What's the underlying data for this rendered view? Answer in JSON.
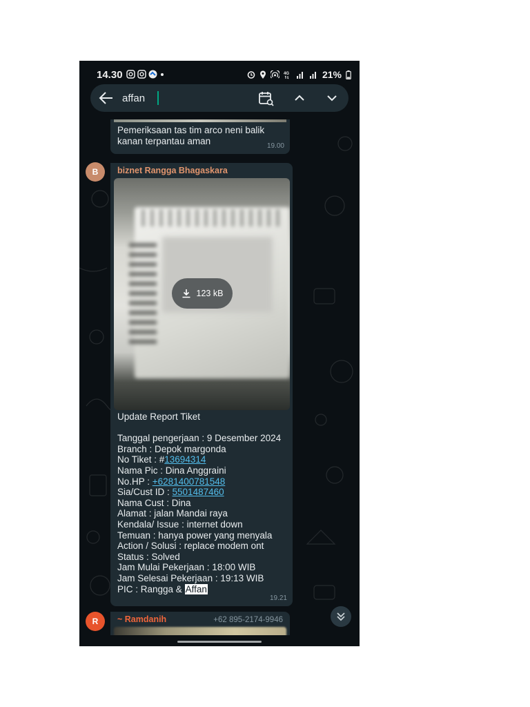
{
  "status_bar": {
    "time": "14.30",
    "battery": "21%"
  },
  "search": {
    "query": "affan"
  },
  "messages": [
    {
      "text_lines": [
        "Pemeriksaan tas tim arco neni balik",
        "kanan terpantau aman"
      ],
      "time": "19.00"
    },
    {
      "avatar_letter": "B",
      "avatar_color": "#c88b6b",
      "sender": "biznet Rangga Bhagaskara",
      "sender_color": "#e0946d",
      "attachment_size": "123 kB",
      "report": {
        "title": "Update Report Tiket",
        "tanggal": "Tanggal pengerjaan : 9 Desember 2024",
        "branch": "Branch : Depok margonda",
        "tiket_label": "No Tiket :  #",
        "tiket_value": "13694314",
        "pic": "Nama Pic : Dina Anggraini",
        "hp_label": "No.HP  : ",
        "hp_value": "+6281400781548",
        "cust_label": "Sia/Cust ID  : ",
        "cust_value": "5501487460",
        "nama_cust": "Nama Cust : Dina",
        "alamat": "Alamat : jalan Mandai raya",
        "kendala": "Kendala/ Issue :  internet down",
        "temuan": "Temuan : hanya power yang menyala",
        "action": "Action / Solusi : replace modem ont",
        "status": "Status : Solved",
        "mulai": "Jam Mulai Pekerjaan : 18:00 WIB",
        "selesai": "Jam Selesai Pekerjaan : 19:13 WIB",
        "pic_label": "PIC : Rangga & ",
        "pic_highlight": "Affan"
      },
      "time": "19.21"
    },
    {
      "avatar_letter": "R",
      "avatar_color": "#e8542c",
      "sender": "~ Ramdanih",
      "sender_color": "#f0653a",
      "phone": "+62 895-2174-9946"
    }
  ],
  "colors": {
    "link": "#53bdeb",
    "accent": "#00a884",
    "bubble": "#1f2c33",
    "background": "#0b1014"
  },
  "icons": [
    "back-arrow-icon",
    "calendar-search-icon",
    "chevron-up-icon",
    "chevron-down-icon",
    "download-icon",
    "double-chevron-down-icon"
  ]
}
